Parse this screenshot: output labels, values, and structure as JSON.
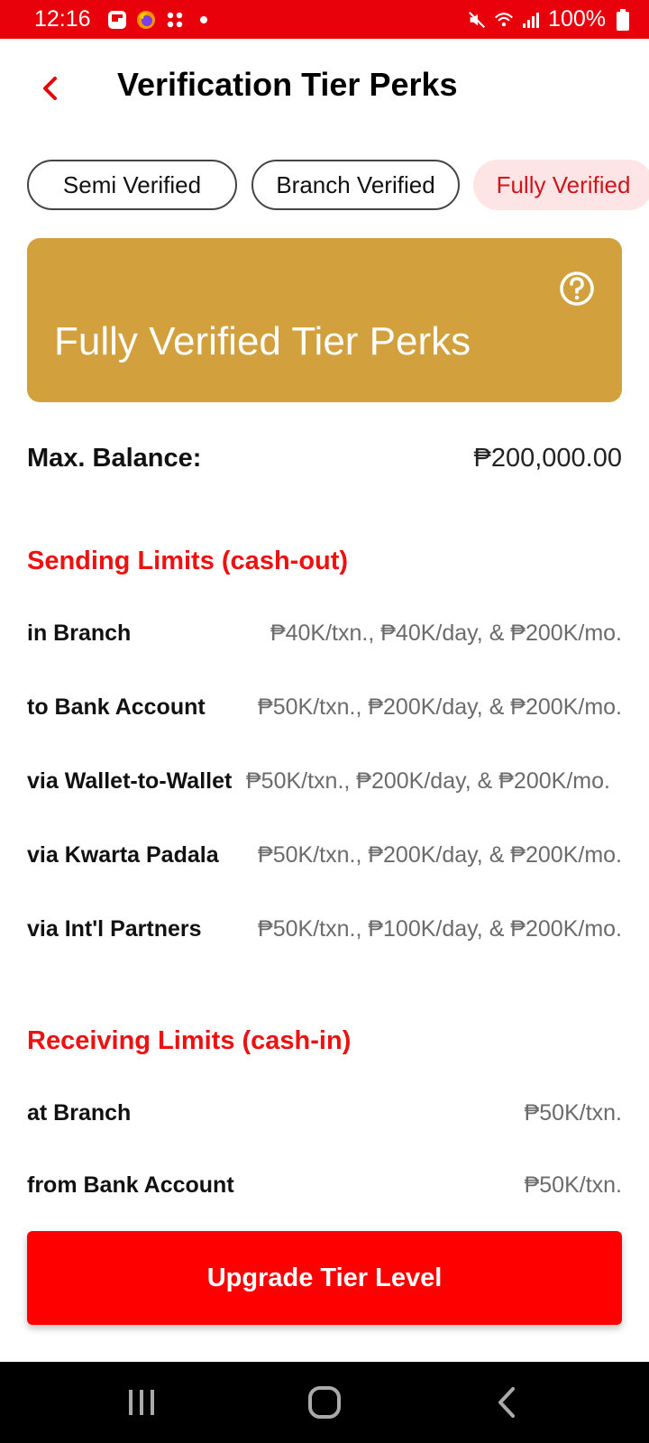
{
  "status_bar": {
    "time": "12:16",
    "battery": "100%",
    "icons": [
      "flipboard-icon",
      "firefox-icon",
      "apps-icon",
      "dot-icon",
      "mute-icon",
      "wifi-icon",
      "signal-icon",
      "battery-icon"
    ]
  },
  "header": {
    "title": "Verification Tier Perks",
    "back_icon": "chevron-left-icon"
  },
  "tabs": [
    {
      "label": "Semi Verified",
      "active": false
    },
    {
      "label": "Branch Verified",
      "active": false
    },
    {
      "label": "Fully Verified",
      "active": true
    }
  ],
  "tier_card": {
    "title": "Fully Verified Tier Perks",
    "color": "#d2a03d",
    "help_icon": "question-circle-icon"
  },
  "balance": {
    "label": "Max. Balance:",
    "value": "₱200,000.00"
  },
  "sending": {
    "title": "Sending Limits (cash-out)",
    "rows": [
      {
        "label": "in Branch",
        "value": "₱40K/txn., ₱40K/day, & ₱200K/mo."
      },
      {
        "label": "to Bank Account",
        "value": "₱50K/txn., ₱200K/day, & ₱200K/mo."
      },
      {
        "label": "via Wallet-to-Wallet",
        "value": "₱50K/txn., ₱200K/day, & ₱200K/mo."
      },
      {
        "label": "via Kwarta Padala",
        "value": "₱50K/txn., ₱200K/day, & ₱200K/mo."
      },
      {
        "label": "via Int'l Partners",
        "value": "₱50K/txn., ₱100K/day, & ₱200K/mo."
      }
    ]
  },
  "receiving": {
    "title": "Receiving Limits (cash-in)",
    "rows": [
      {
        "label": "at Branch",
        "value": "₱50K/txn."
      },
      {
        "label": "from Bank Account",
        "value": "₱50K/txn."
      }
    ]
  },
  "footer": {
    "upgrade_label": "Upgrade Tier Level"
  },
  "colors": {
    "accent_red": "#ff0000",
    "status_bar": "#e8000b",
    "tab_active_bg": "#fde4e5",
    "tab_active_text": "#d0141b"
  },
  "nav_bar": {
    "icons": [
      "recents-icon",
      "home-icon",
      "back-icon"
    ]
  }
}
